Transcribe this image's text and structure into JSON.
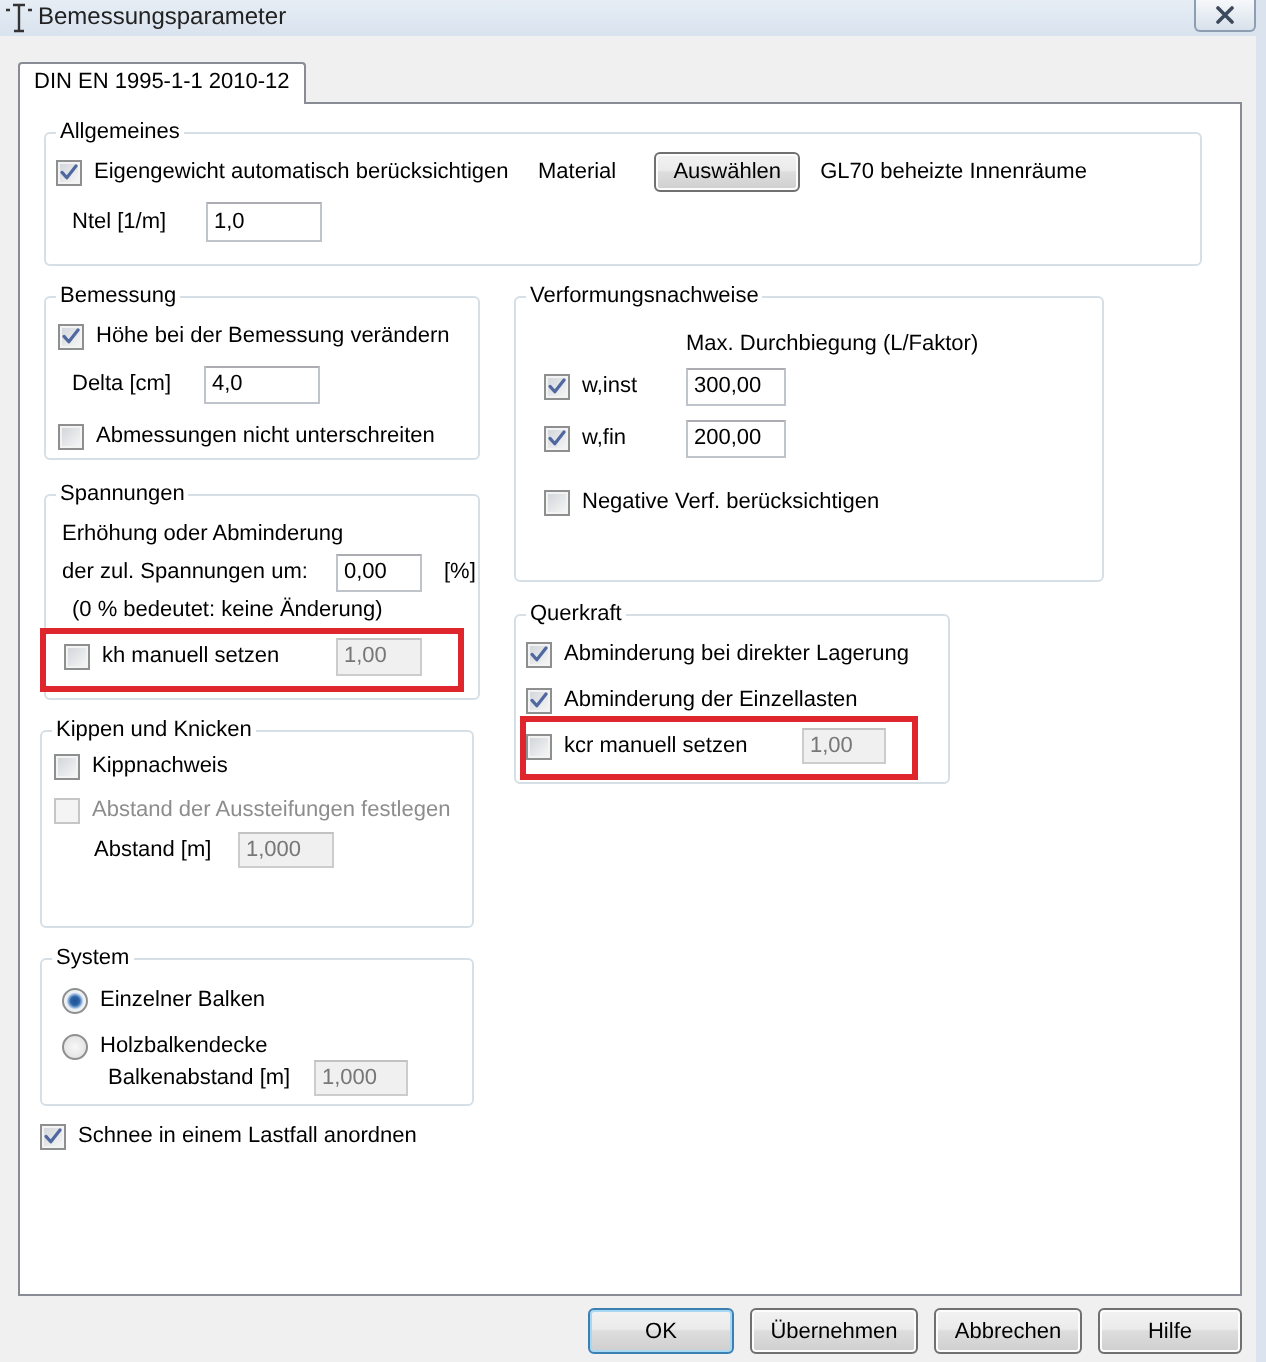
{
  "window": {
    "title": "Bemessungsparameter"
  },
  "tabs": [
    {
      "label": "DIN EN 1995-1-1 2010-12",
      "selected": true
    }
  ],
  "allgemeines": {
    "title": "Allgemeines",
    "eigengewicht": {
      "label": "Eigengewicht automatisch berücksichtigen",
      "checked": true
    },
    "material_label": "Material",
    "material_button": "Auswählen",
    "material_name": "GL70 beheizte Innenräume",
    "ntel": {
      "label": "Ntel [1/m]",
      "value": "1,0"
    }
  },
  "bemessung": {
    "title": "Bemessung",
    "hoehe": {
      "label": "Höhe bei der Bemessung verändern",
      "checked": true
    },
    "delta": {
      "label": "Delta [cm]",
      "value": "4,0"
    },
    "abmessungen": {
      "label": "Abmessungen nicht unterschreiten",
      "checked": false
    }
  },
  "spannungen": {
    "title": "Spannungen",
    "description": "Erhöhung oder Abminderung",
    "aenderung": {
      "label": "der zul. Spannungen um:",
      "value": "0,00",
      "unit": "[%]"
    },
    "hint": "(0 % bedeutet: keine Änderung)",
    "kh": {
      "label": "kh manuell setzen",
      "checked": false,
      "highlighted": true,
      "field": {
        "value": "1,00",
        "disabled": true
      }
    }
  },
  "kippen": {
    "title": "Kippen und Knicken",
    "options": [
      {
        "label": "Kippnachweis",
        "checked": false,
        "disabled": false
      },
      {
        "label": "Abstand der Aussteifungen festlegen",
        "checked": false,
        "disabled": true
      }
    ],
    "abstand": {
      "label": "Abstand [m]",
      "value": "1,000",
      "disabled": true
    }
  },
  "system": {
    "title": "System",
    "options": [
      {
        "label": "Einzelner Balken",
        "selected": true
      },
      {
        "label": "Holzbalkendecke",
        "selected": false
      }
    ],
    "balkenabstand": {
      "label": "Balkenabstand [m]",
      "value": "1,000",
      "disabled": true
    }
  },
  "schnee": {
    "label": "Schnee in einem Lastfall anordnen",
    "checked": true
  },
  "verformung": {
    "title": "Verformungsnachweise",
    "heading": "Max. Durchbiegung (L/Faktor)",
    "limits": [
      {
        "label": "w,inst",
        "checked": true,
        "value": "300,00"
      },
      {
        "label": "w,fin",
        "checked": true,
        "value": "200,00"
      }
    ],
    "negative": {
      "label": "Negative Verf. berücksichtigen",
      "checked": false
    }
  },
  "querkraft": {
    "title": "Querkraft",
    "options": [
      {
        "label": "Abminderung bei direkter Lagerung",
        "checked": true
      },
      {
        "label": "Abminderung der Einzellasten",
        "checked": true
      }
    ],
    "kcr": {
      "label": "kcr manuell setzen",
      "checked": false,
      "highlighted": true,
      "field": {
        "value": "1,00",
        "disabled": true
      }
    }
  },
  "buttons": [
    {
      "label": "OK",
      "default": true
    },
    {
      "label": "Übernehmen",
      "default": false
    },
    {
      "label": "Abbrechen",
      "default": false
    },
    {
      "label": "Hilfe",
      "default": false
    }
  ]
}
